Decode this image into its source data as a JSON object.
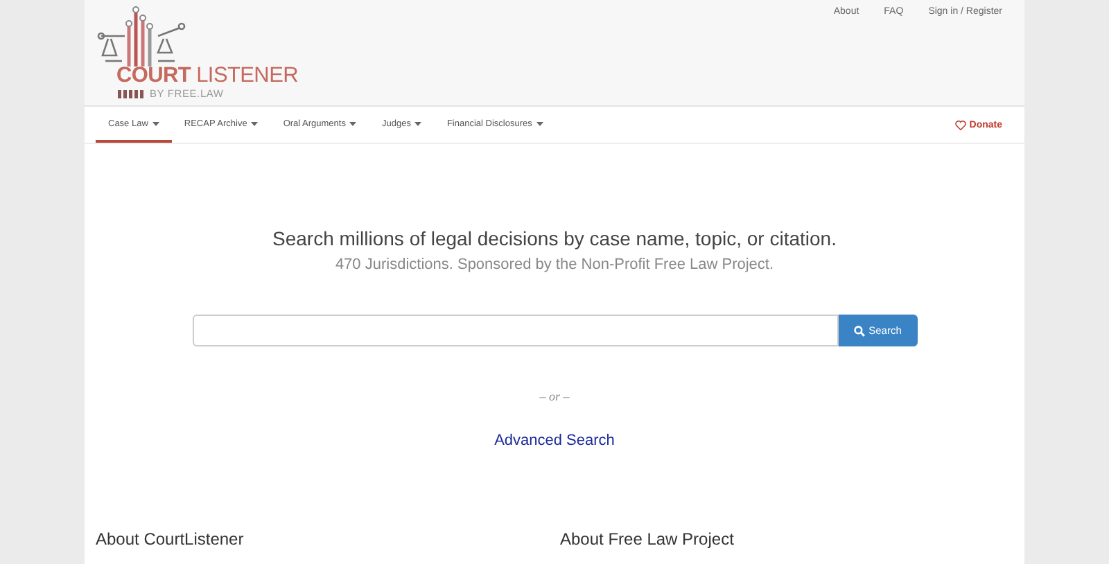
{
  "top_links": [
    "About",
    "FAQ",
    "Sign in / Register"
  ],
  "logo": {
    "title": "**COURT** LISTENER",
    "tagline": "BY FREE.LAW"
  },
  "nav": [
    {
      "label": "Case Law",
      "selected": true
    },
    {
      "label": "RECAP Archive",
      "selected": false
    },
    {
      "label": "Oral Arguments",
      "selected": false
    },
    {
      "label": "Judges",
      "selected": false
    },
    {
      "label": "Financial Disclosures",
      "selected": false
    }
  ],
  "donate": "Donate",
  "headline": "Search millions of legal decisions by case name, topic, or citation.",
  "subtitle": "470 Jurisdictions. Sponsored by the Non-Profit Free Law Project.",
  "search_button": "Search",
  "or": "– or –",
  "advanced_link": "Advanced Search",
  "sections": [
    "About CourtListener",
    "About Free Law Project"
  ]
}
